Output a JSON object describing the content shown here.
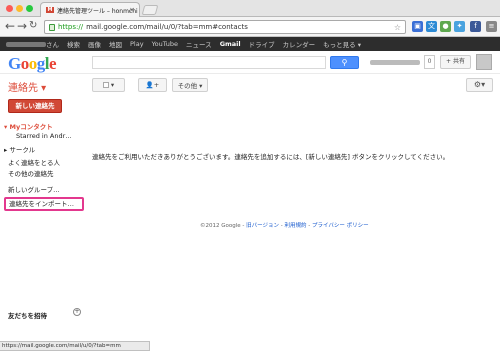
{
  "browser": {
    "tab_title": "連絡先管理ツール – honmchi",
    "tab_favicon": "M",
    "url_scheme": "https://",
    "url_rest": "mail.google.com/mail/u/0/?tab=mm#contacts",
    "status_url": "https://mail.google.com/mail/u/0/?tab=mm"
  },
  "gbar": {
    "user_suffix": "さん",
    "items": [
      "検索",
      "画像",
      "地図",
      "Play",
      "YouTube",
      "ニュース",
      "Gmail",
      "ドライブ",
      "カレンダー",
      "もっと見る ▾"
    ],
    "active": "Gmail"
  },
  "header": {
    "logo": "Google",
    "logo_colors": [
      "#4285f4",
      "#ea4335",
      "#fbbc05",
      "#4285f4",
      "#34a853",
      "#ea4335"
    ],
    "notification_count": "0",
    "share_label": "+ 共有"
  },
  "actionbar": {
    "title": "連絡先 ▾",
    "add_person_icon": "person-plus-icon",
    "more_label": "その他 ▾",
    "settings_icon": "gear-icon"
  },
  "sidebar": {
    "new_contact_label": "新しい連絡先",
    "my_contacts_label": "▾ Myコンタクト",
    "starred_label": "Starred in Andr…",
    "circles_label": "▸ サークル",
    "frequent_label": "よく連絡をとる人",
    "other_label": "その他の連絡先",
    "new_group_label": "新しいグループ…",
    "import_label": "連絡先をインポート…",
    "invite_label": "友だちを招待",
    "invite_plus": "+"
  },
  "main": {
    "empty_message": "連絡先をご利用いただきありがとうございます。連絡先を追加するには、[新しい連絡先] ボタンをクリックしてください。",
    "footer_copyright": "©2012 Google - ",
    "footer_links": [
      "旧バージョン",
      "利用規約",
      "プライバシー ポリシー"
    ]
  },
  "colors": {
    "accent_red": "#dd4b39",
    "button_red": "#d14836",
    "search_blue": "#4d90fe",
    "highlight_pink": "#e3388e"
  }
}
